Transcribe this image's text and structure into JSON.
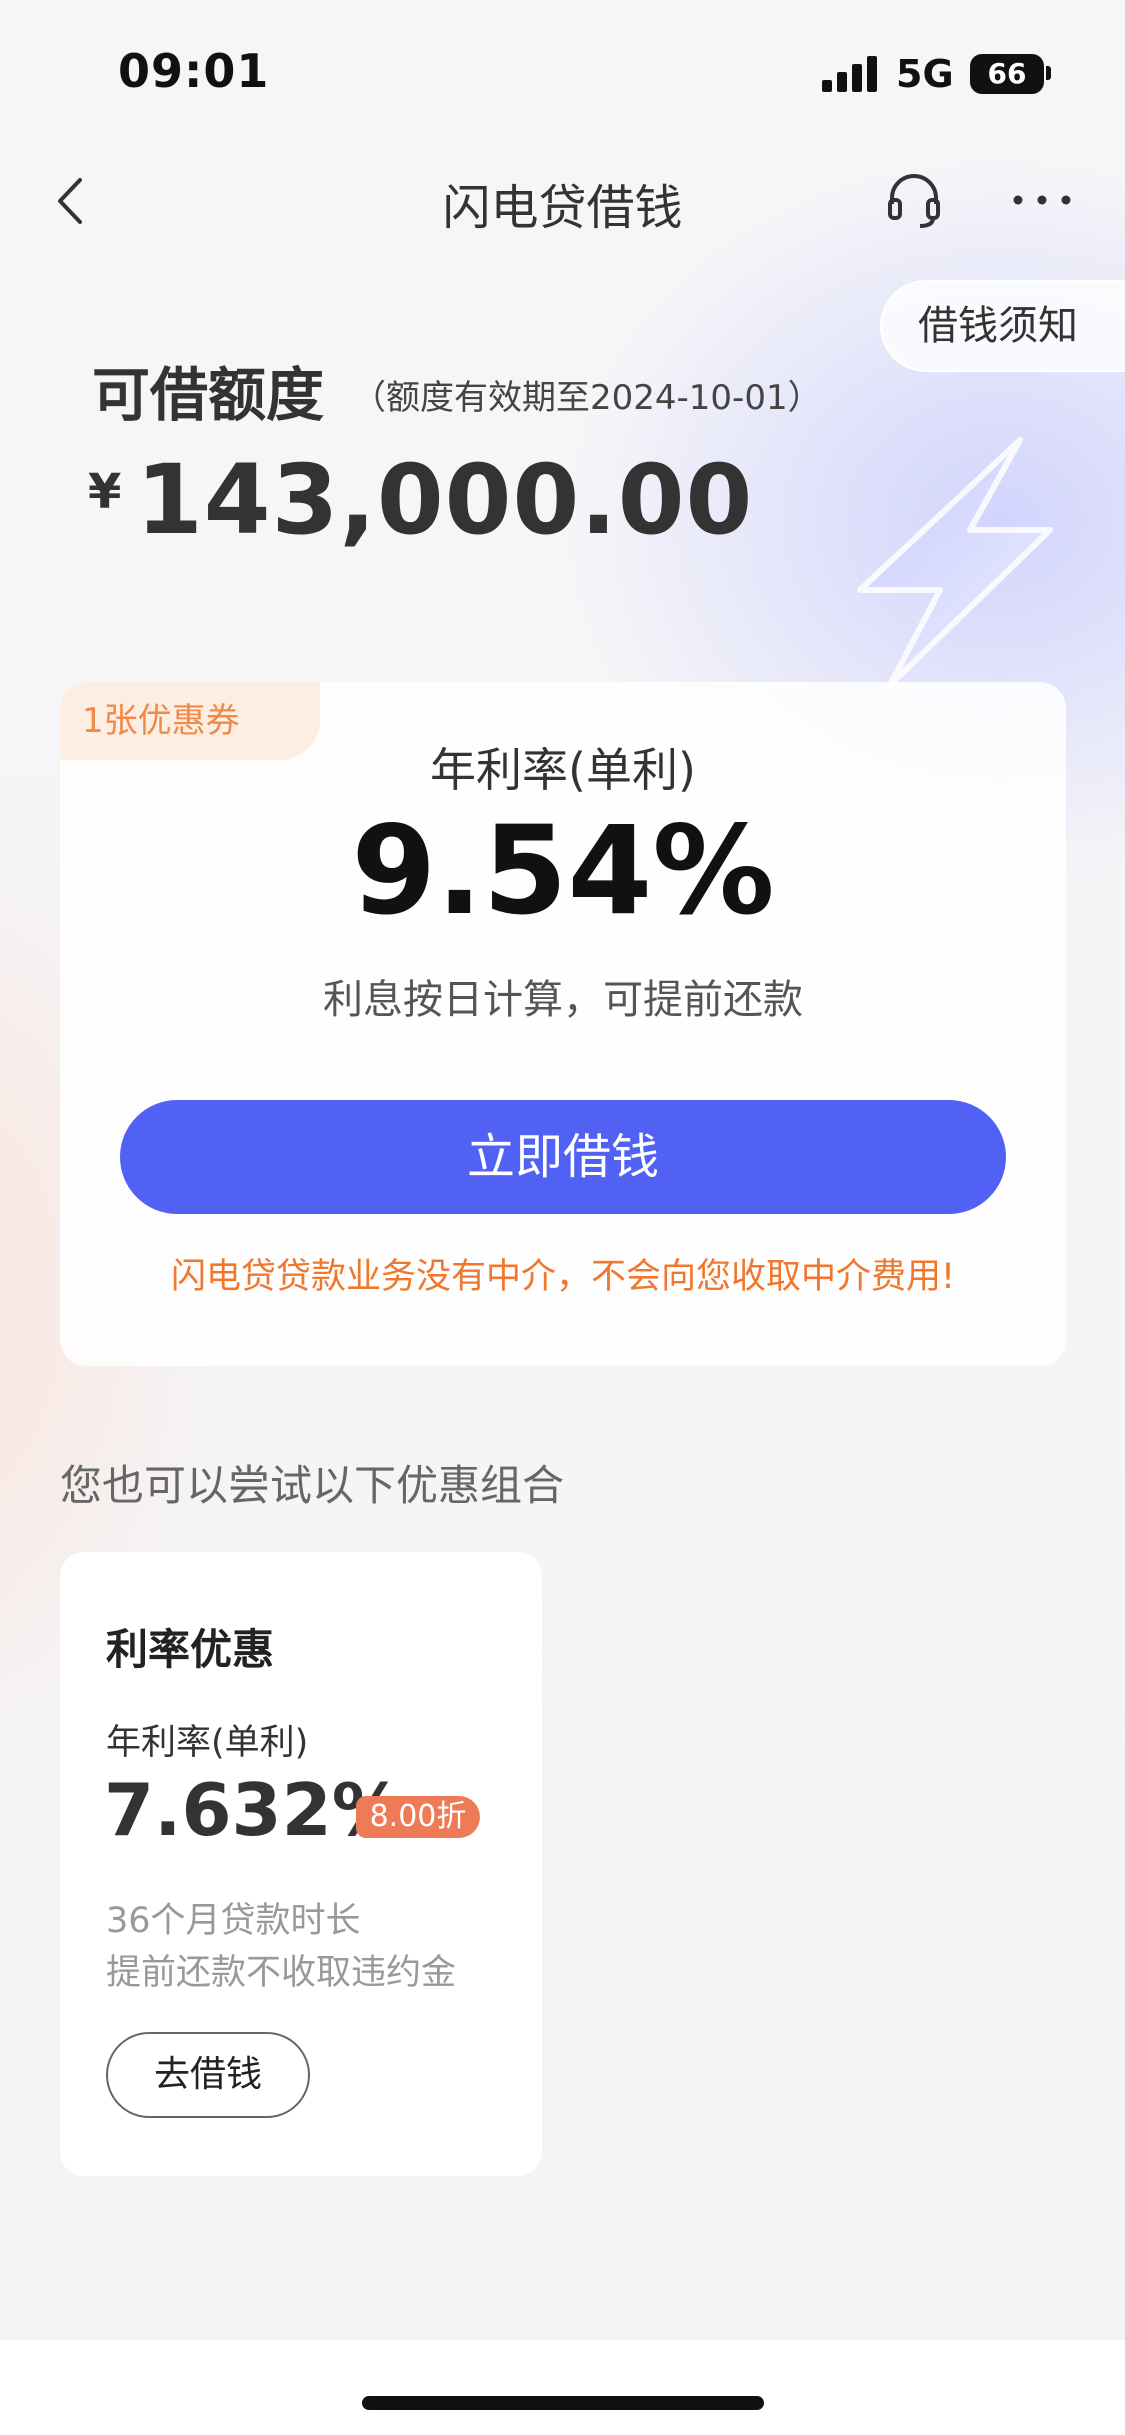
{
  "status_bar": {
    "time": "09:01",
    "network": "5G",
    "battery": "66"
  },
  "nav": {
    "title": "闪电贷借钱",
    "back_icon": "chevron-left-icon",
    "service_icon": "headset-icon",
    "more_icon": "more-dots-icon"
  },
  "notice": {
    "label": "借钱须知"
  },
  "limit": {
    "title": "可借额度",
    "validity": "（额度有效期至2024-10-01）",
    "currency": "¥",
    "amount": "143,000.00"
  },
  "main_card": {
    "coupon": "1张优惠券",
    "rate_label": "年利率(单利)",
    "rate_value": "9.54%",
    "rate_desc": "利息按日计算，可提前还款",
    "button_label": "立即借钱",
    "warning": "闪电贷贷款业务没有中介，不会向您收取中介费用!"
  },
  "combos": {
    "title": "您也可以尝试以下优惠组合",
    "items": [
      {
        "title": "利率优惠",
        "rate_label": "年利率(单利)",
        "rate": "7.632%",
        "discount": "8.00折",
        "term": "36个月贷款时长",
        "note": "提前还款不收取违约金",
        "button_label": "去借钱"
      }
    ]
  },
  "colors": {
    "accent": "#5161f4",
    "warning": "#f0782e",
    "coupon_text": "#f08a4b",
    "discount_badge": "#ef7a56"
  }
}
